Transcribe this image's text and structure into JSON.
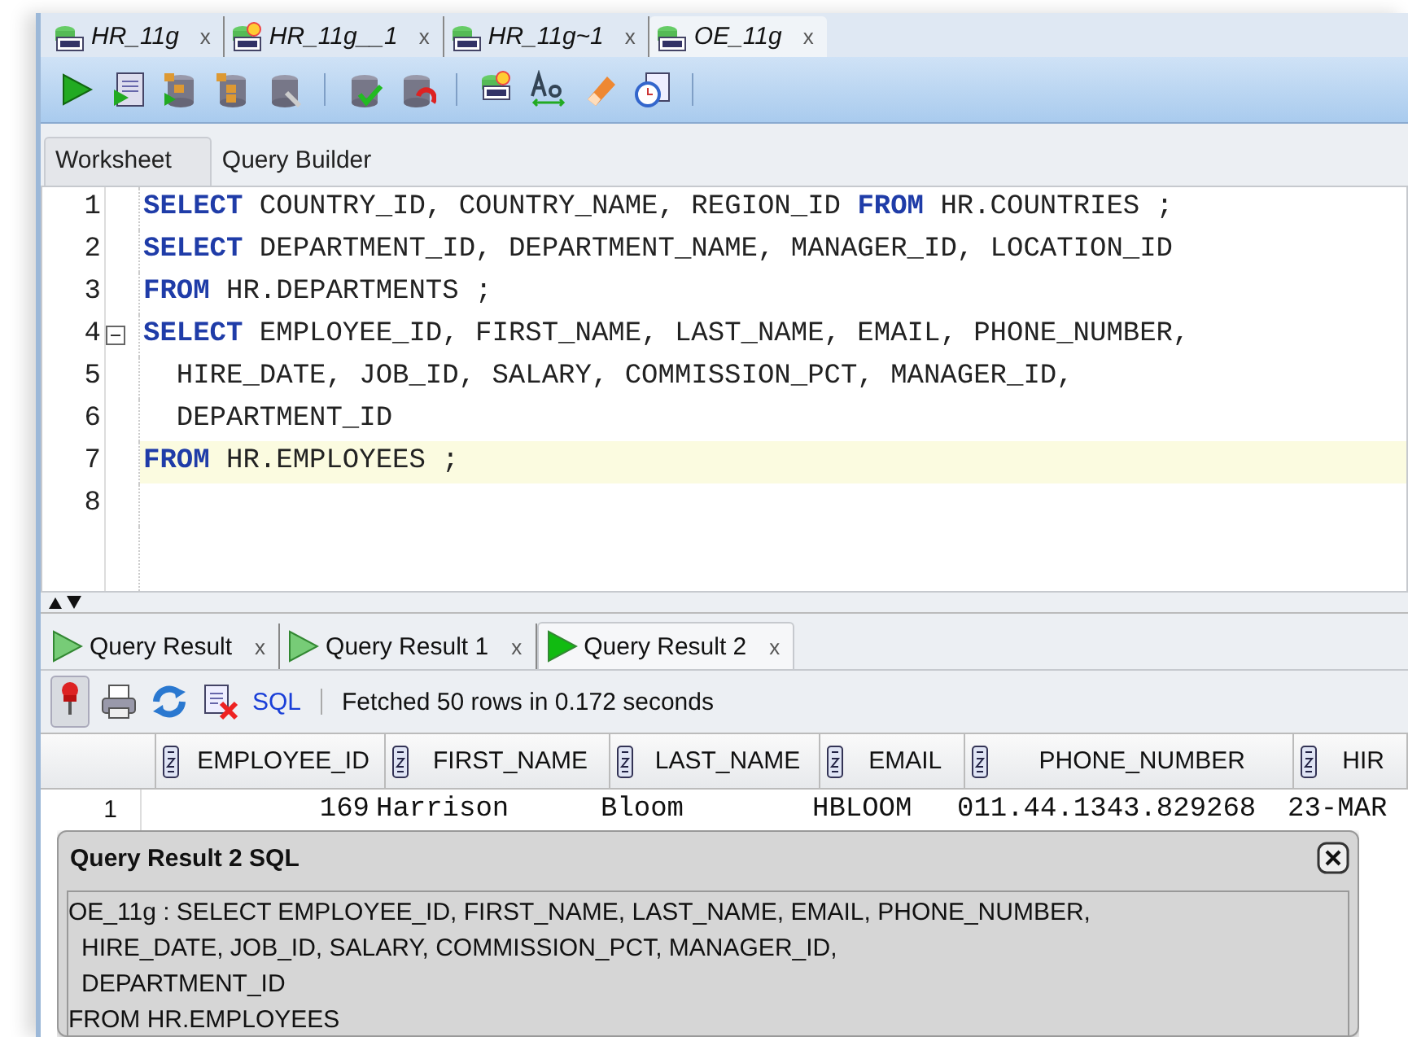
{
  "document_tabs": [
    {
      "label": "HR_11g",
      "close": "x",
      "selected": false,
      "badge": false
    },
    {
      "label": "HR_11g__1",
      "close": "x",
      "selected": false,
      "badge": true
    },
    {
      "label": "HR_11g~1",
      "close": "x",
      "selected": false,
      "badge": false
    },
    {
      "label": "OE_11g",
      "close": "x",
      "selected": true,
      "badge": false
    }
  ],
  "worksheet_tabs": [
    {
      "label": "Worksheet",
      "selected": true
    },
    {
      "label": "Query Builder",
      "selected": false
    }
  ],
  "editor": {
    "lines": [
      {
        "number": "1",
        "fold": false,
        "current": false,
        "tokens": [
          {
            "kind": "keyword",
            "text": "SELECT"
          },
          {
            "kind": "plain",
            "text": " COUNTRY_ID, COUNTRY_NAME, REGION_ID "
          },
          {
            "kind": "keyword",
            "text": "FROM"
          },
          {
            "kind": "plain",
            "text": " HR.COUNTRIES ;"
          }
        ]
      },
      {
        "number": "2",
        "fold": false,
        "current": false,
        "tokens": [
          {
            "kind": "keyword",
            "text": "SELECT"
          },
          {
            "kind": "plain",
            "text": " DEPARTMENT_ID, DEPARTMENT_NAME, MANAGER_ID, LOCATION_ID"
          }
        ]
      },
      {
        "number": "3",
        "fold": false,
        "current": false,
        "tokens": [
          {
            "kind": "keyword",
            "text": "FROM"
          },
          {
            "kind": "plain",
            "text": " HR.DEPARTMENTS ;"
          }
        ]
      },
      {
        "number": "4",
        "fold": true,
        "current": false,
        "tokens": [
          {
            "kind": "keyword",
            "text": "SELECT"
          },
          {
            "kind": "plain",
            "text": " EMPLOYEE_ID, FIRST_NAME, LAST_NAME, EMAIL, PHONE_NUMBER,"
          }
        ]
      },
      {
        "number": "5",
        "fold": false,
        "current": false,
        "tokens": [
          {
            "kind": "plain",
            "text": "  HIRE_DATE, JOB_ID, SALARY, COMMISSION_PCT, MANAGER_ID,"
          }
        ]
      },
      {
        "number": "6",
        "fold": false,
        "current": false,
        "tokens": [
          {
            "kind": "plain",
            "text": "  DEPARTMENT_ID"
          }
        ]
      },
      {
        "number": "7",
        "fold": false,
        "current": true,
        "tokens": [
          {
            "kind": "keyword",
            "text": "FROM"
          },
          {
            "kind": "plain",
            "text": " HR.EMPLOYEES ;"
          }
        ]
      },
      {
        "number": "8",
        "fold": false,
        "current": false
      }
    ]
  },
  "result_tabs": [
    {
      "label": "Query Result",
      "close": "x",
      "selected": false
    },
    {
      "label": "Query Result 1",
      "close": "x",
      "selected": false
    },
    {
      "label": "Query Result 2",
      "close": "x",
      "selected": true
    }
  ],
  "result_toolbar": {
    "pinned": true,
    "sql_link": "SQL",
    "status": "Fetched 50 rows in 0.172 seconds"
  },
  "grid": {
    "columns": [
      "EMPLOYEE_ID",
      "FIRST_NAME",
      "LAST_NAME",
      "EMAIL",
      "PHONE_NUMBER",
      "HIR"
    ],
    "rows": [
      {
        "number": "1",
        "cells": [
          "169",
          "Harrison",
          "Bloom",
          "HBLOOM",
          "011.44.1343.829268",
          "23-MAR"
        ]
      }
    ]
  },
  "sql_popup": {
    "title": "Query Result 2 SQL",
    "lines": [
      {
        "text": "OE_11g : SELECT EMPLOYEE_ID, FIRST_NAME, LAST_NAME, EMAIL, PHONE_NUMBER,",
        "indented": false
      },
      {
        "text": "HIRE_DATE, JOB_ID, SALARY, COMMISSION_PCT, MANAGER_ID,",
        "indented": true
      },
      {
        "text": "DEPARTMENT_ID",
        "indented": true
      },
      {
        "text": "FROM HR.EMPLOYEES",
        "indented": false
      }
    ]
  }
}
